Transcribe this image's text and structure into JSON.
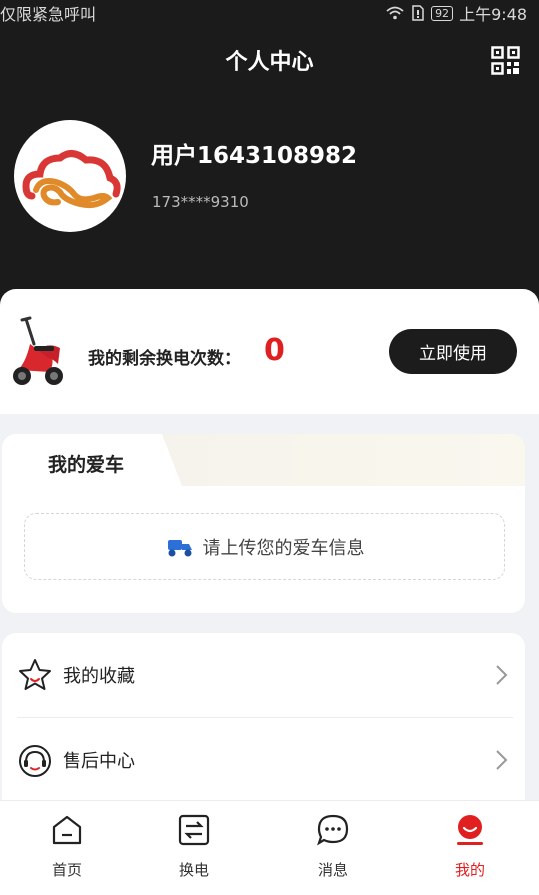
{
  "status_bar": {
    "left_text": "仅限紧急呼叫",
    "battery": "92",
    "time": "上午9:48"
  },
  "nav": {
    "title": "个人中心",
    "qr_icon": "qr-code-icon"
  },
  "profile": {
    "username": "用户1643108982",
    "phone": "173****9310",
    "avatar_icon": "cloud-logo-icon"
  },
  "swap": {
    "label": "我的剩余换电次数：",
    "count": "0",
    "button": "立即使用",
    "image": "scooter-icon"
  },
  "my_car": {
    "tab_label": "我的爱车",
    "upload_text": "请上传您的爱车信息",
    "upload_icon": "scooter-icon"
  },
  "menu": {
    "items": [
      {
        "label": "我的收藏",
        "icon": "star-icon"
      },
      {
        "label": "售后中心",
        "icon": "headset-icon"
      }
    ]
  },
  "tabbar": {
    "items": [
      {
        "label": "首页",
        "icon": "home-icon"
      },
      {
        "label": "换电",
        "icon": "swap-icon"
      },
      {
        "label": "消息",
        "icon": "message-icon"
      },
      {
        "label": "我的",
        "icon": "profile-icon"
      }
    ],
    "active_index": 3,
    "active_color": "#e02020"
  },
  "colors": {
    "header_bg": "#1b1b1b",
    "accent": "#e02020",
    "button_bg": "#1c1c1c"
  }
}
